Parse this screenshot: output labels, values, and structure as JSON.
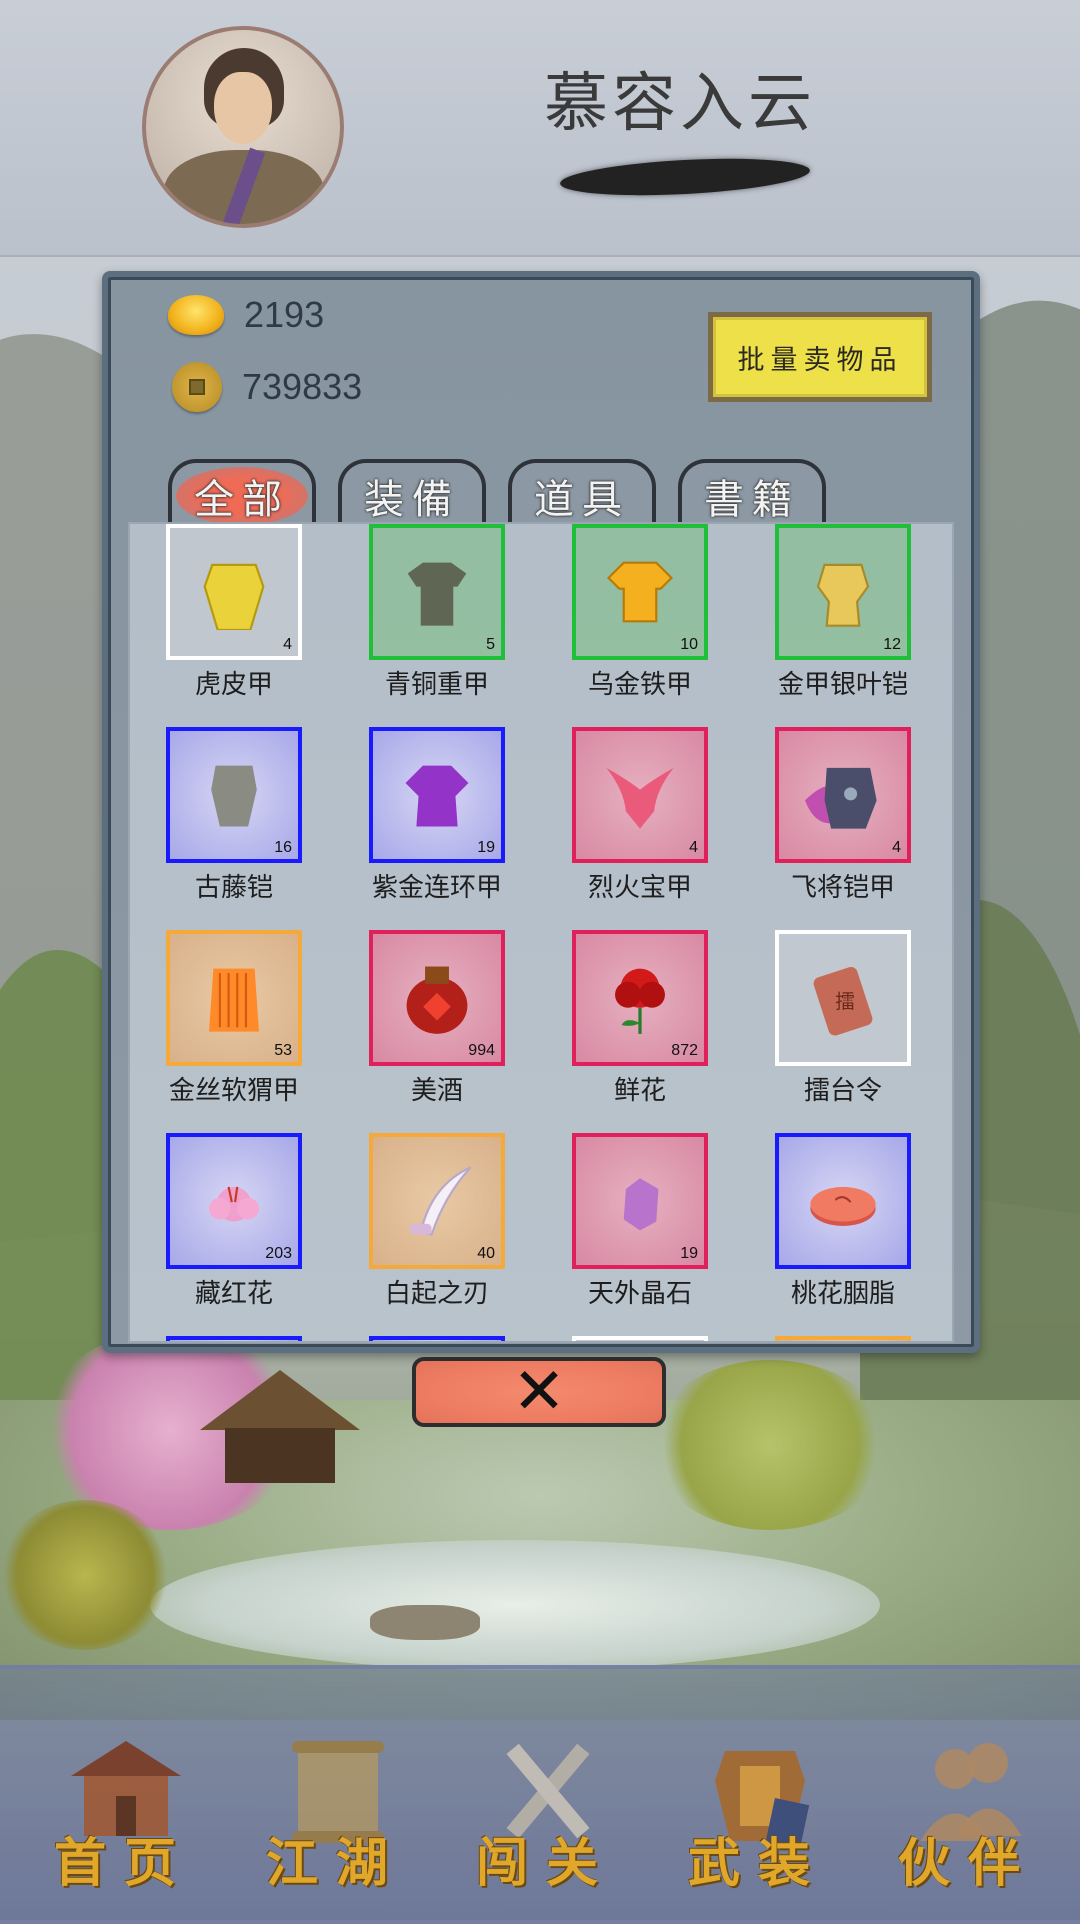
{
  "header": {
    "character_name": "慕容入云"
  },
  "currency": {
    "gold_ingots": "2193",
    "copper_coins": "739833"
  },
  "buttons": {
    "bulk_sell": "批量卖物品",
    "close": "✕"
  },
  "tabs": [
    {
      "label": "全部",
      "active": true
    },
    {
      "label": "装備",
      "active": false
    },
    {
      "label": "道具",
      "active": false
    },
    {
      "label": "書籍",
      "active": false
    }
  ],
  "items": [
    {
      "name": "虎皮甲",
      "count": "4",
      "quality": "white",
      "icon": "tiger-armor-icon"
    },
    {
      "name": "青铜重甲",
      "count": "5",
      "quality": "green",
      "icon": "bronze-armor-icon"
    },
    {
      "name": "乌金铁甲",
      "count": "10",
      "quality": "green",
      "icon": "black-gold-armor-icon"
    },
    {
      "name": "金甲银叶铠",
      "count": "12",
      "quality": "green",
      "icon": "gold-silver-armor-icon"
    },
    {
      "name": "古藤铠",
      "count": "16",
      "quality": "blue",
      "icon": "vine-armor-icon"
    },
    {
      "name": "紫金连环甲",
      "count": "19",
      "quality": "blue",
      "icon": "purple-armor-icon"
    },
    {
      "name": "烈火宝甲",
      "count": "4",
      "quality": "red",
      "icon": "fire-armor-icon"
    },
    {
      "name": "飞将铠甲",
      "count": "4",
      "quality": "red",
      "icon": "winged-armor-icon"
    },
    {
      "name": "金丝软猬甲",
      "count": "53",
      "quality": "orange",
      "icon": "gold-silk-armor-icon"
    },
    {
      "name": "美酒",
      "count": "994",
      "quality": "red",
      "icon": "wine-jar-icon"
    },
    {
      "name": "鲜花",
      "count": "872",
      "quality": "red",
      "icon": "rose-icon"
    },
    {
      "name": "擂台令",
      "count": "",
      "quality": "white",
      "icon": "token-icon"
    },
    {
      "name": "藏红花",
      "count": "203",
      "quality": "blue",
      "icon": "saffron-flower-icon"
    },
    {
      "name": "白起之刃",
      "count": "40",
      "quality": "orange",
      "icon": "curved-blade-icon"
    },
    {
      "name": "天外晶石",
      "count": "19",
      "quality": "red",
      "icon": "crystal-icon"
    },
    {
      "name": "桃花胭脂",
      "count": "",
      "quality": "blue",
      "icon": "rouge-box-icon"
    }
  ],
  "partial_row_qualities": [
    "blue",
    "blue",
    "white",
    "orange"
  ],
  "bottom_nav": [
    {
      "label": "首页",
      "icon": "house-icon"
    },
    {
      "label": "江湖",
      "icon": "scroll-icon"
    },
    {
      "label": "闯关",
      "icon": "crossed-swords-icon"
    },
    {
      "label": "武装",
      "icon": "armor-book-icon"
    },
    {
      "label": "伙伴",
      "icon": "companions-icon"
    }
  ],
  "colors": {
    "quality_white": "#ffffff",
    "quality_green": "#1fbf3a",
    "quality_blue": "#1a1aff",
    "quality_red": "#e0205a",
    "quality_orange": "#f5a93a",
    "nav_label": "#e0a72a",
    "sell_button": "#ede048",
    "close_button": "#ee7d62"
  }
}
